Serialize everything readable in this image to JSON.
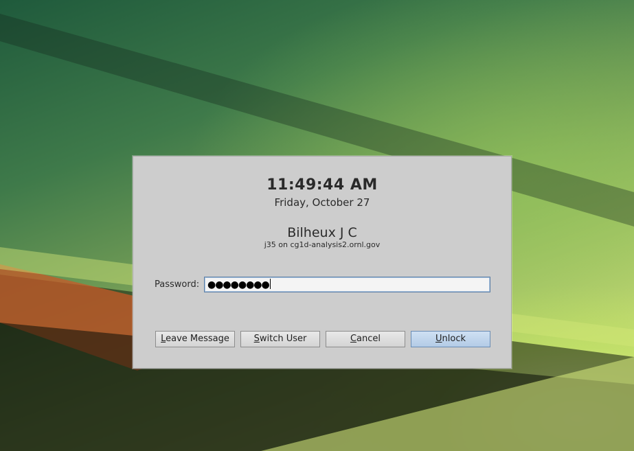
{
  "clock": {
    "time": "11:49:44 AM",
    "date": "Friday, October 27"
  },
  "user": {
    "name": "Bilheux J C",
    "host_line": "j35 on cg1d-analysis2.ornl.gov"
  },
  "password": {
    "label": "Password:",
    "masked_value": "●●●●●●●●"
  },
  "buttons": {
    "leave_message": {
      "mnemonic": "L",
      "rest": "eave Message"
    },
    "switch_user": {
      "mnemonic": "S",
      "rest": "witch User"
    },
    "cancel": {
      "mnemonic": "C",
      "rest": "ancel"
    },
    "unlock": {
      "mnemonic": "U",
      "rest": "nlock"
    }
  },
  "colors": {
    "dialog_bg": "#cdcdcd",
    "default_button": "#b3cbe6"
  }
}
